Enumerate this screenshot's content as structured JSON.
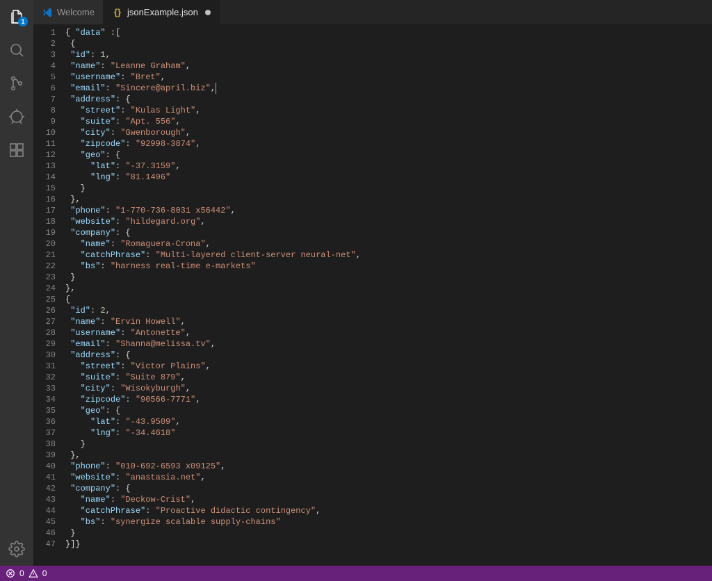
{
  "tabs": [
    {
      "label": "Welcome",
      "kind": "vscode"
    },
    {
      "label": "jsonExample.json",
      "kind": "json",
      "active": true,
      "modified": true
    }
  ],
  "activitybar": {
    "explorer_badge": "1"
  },
  "statusbar": {
    "errors": "0",
    "warnings": "0"
  },
  "json_source": {
    "data": [
      {
        "id": 1,
        "name": "Leanne Graham",
        "username": "Bret",
        "email": "Sincere@april.biz",
        "address": {
          "street": "Kulas Light",
          "suite": "Apt. 556",
          "city": "Gwenborough",
          "zipcode": "92998-3874",
          "geo": {
            "lat": "-37.3159",
            "lng": "81.1496"
          }
        },
        "phone": "1-770-736-8031 x56442",
        "website": "hildegard.org",
        "company": {
          "name": "Romaguera-Crona",
          "catchPhrase": "Multi-layered client-server neural-net",
          "bs": "harness real-time e-markets"
        }
      },
      {
        "id": 2,
        "name": "Ervin Howell",
        "username": "Antonette",
        "email": "Shanna@melissa.tv",
        "address": {
          "street": "Victor Plains",
          "suite": "Suite 879",
          "city": "Wisokyburgh",
          "zipcode": "90566-7771",
          "geo": {
            "lat": "-43.9509",
            "lng": "-34.4618"
          }
        },
        "phone": "010-692-6593 x09125",
        "website": "anastasia.net",
        "company": {
          "name": "Deckow-Crist",
          "catchPhrase": "Proactive didactic contingency",
          "bs": "synergize scalable supply-chains"
        }
      }
    ]
  },
  "cursor": {
    "line": 6,
    "after_comma": true
  }
}
